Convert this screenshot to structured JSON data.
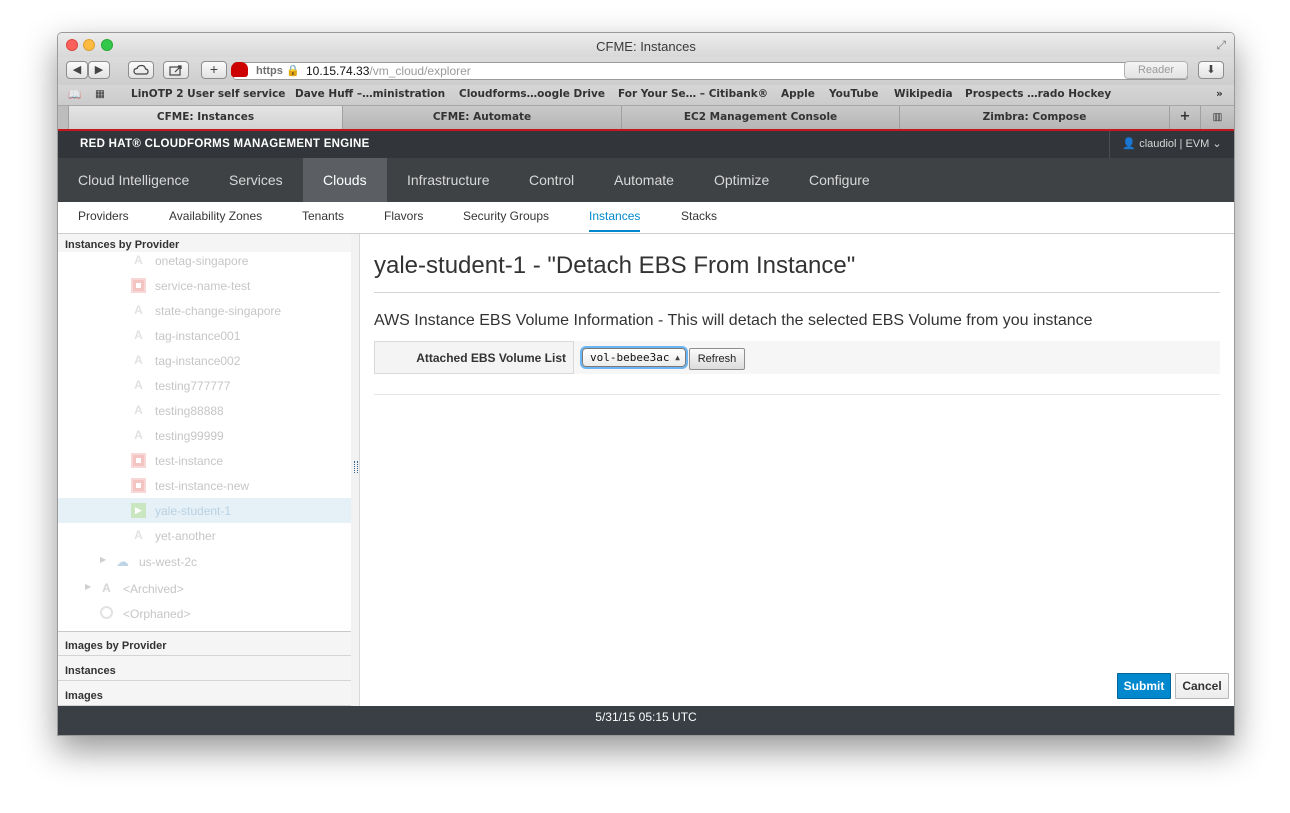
{
  "browser": {
    "window_title": "CFME: Instances",
    "toolbar": {
      "back_icon": "back-arrow-icon",
      "forward_icon": "forward-arrow-icon",
      "cloud_icon": "icloud-icon",
      "share_icon": "share-icon",
      "add_icon": "plus-icon",
      "favicon": "redhat-favicon-icon",
      "https_label": "https",
      "url_host": "10.15.74.33",
      "url_path": "/vm_cloud/explorer",
      "reader_label": "Reader",
      "download_icon": "download-icon"
    },
    "bookmarks": [
      "LinOTP 2 User self service",
      "Dave Huff –…ministration",
      "Cloudforms…oogle Drive",
      "For Your Se… – Citibank®",
      "Apple",
      "YouTube",
      "Wikipedia",
      "Prospects …rado Hockey"
    ],
    "tabs": [
      "CFME: Instances",
      "CFME: Automate",
      "EC2 Management Console",
      "Zimbra: Compose"
    ]
  },
  "header": {
    "brand": "RED HAT® CLOUDFORMS MANAGEMENT ENGINE",
    "user": "claudiol | EVM"
  },
  "main_nav": [
    "Cloud Intelligence",
    "Services",
    "Clouds",
    "Infrastructure",
    "Control",
    "Automate",
    "Optimize",
    "Configure"
  ],
  "main_nav_active": "Clouds",
  "sub_nav": [
    "Providers",
    "Availability Zones",
    "Tenants",
    "Flavors",
    "Security Groups",
    "Instances",
    "Stacks"
  ],
  "sub_nav_active": "Instances",
  "sidebar": {
    "tree_title": "Instances by Provider",
    "tree_nodes": [
      {
        "label": "onetag-singapore",
        "icon": "a-icon"
      },
      {
        "label": "service-name-test",
        "icon": "stopped-icon"
      },
      {
        "label": "state-change-singapore",
        "icon": "a-icon"
      },
      {
        "label": "tag-instance001",
        "icon": "a-icon"
      },
      {
        "label": "tag-instance002",
        "icon": "a-icon"
      },
      {
        "label": "testing777777",
        "icon": "a-icon"
      },
      {
        "label": "testing88888",
        "icon": "a-icon"
      },
      {
        "label": "testing99999",
        "icon": "a-icon"
      },
      {
        "label": "test-instance",
        "icon": "stopped-icon"
      },
      {
        "label": "test-instance-new",
        "icon": "stopped-icon"
      },
      {
        "label": "yale-student-1",
        "icon": "running-icon",
        "selected": true
      },
      {
        "label": "yet-another",
        "icon": "a-icon"
      },
      {
        "label": "us-west-2c",
        "icon": "cloud-icon"
      },
      {
        "label": "<Archived>",
        "icon": "archived-icon"
      },
      {
        "label": "<Orphaned>",
        "icon": "orphaned-icon"
      }
    ],
    "accordions": [
      "Images by Provider",
      "Instances",
      "Images"
    ]
  },
  "content": {
    "title": "yale-student-1 - \"Detach EBS From Instance\"",
    "section_title": "AWS Instance EBS Volume Information - This will detach the selected EBS Volume from you instance",
    "volume_label": "Attached EBS Volume List",
    "volume_selected": "vol-bebee3ac",
    "refresh_label": "Refresh",
    "submit_label": "Submit",
    "cancel_label": "Cancel"
  },
  "footer": {
    "timestamp": "5/31/15 05:15 UTC"
  },
  "colors": {
    "accent": "#0088ce",
    "masthead": "#323539",
    "nav": "#3f4245",
    "tab_underline": "#c6161e"
  }
}
